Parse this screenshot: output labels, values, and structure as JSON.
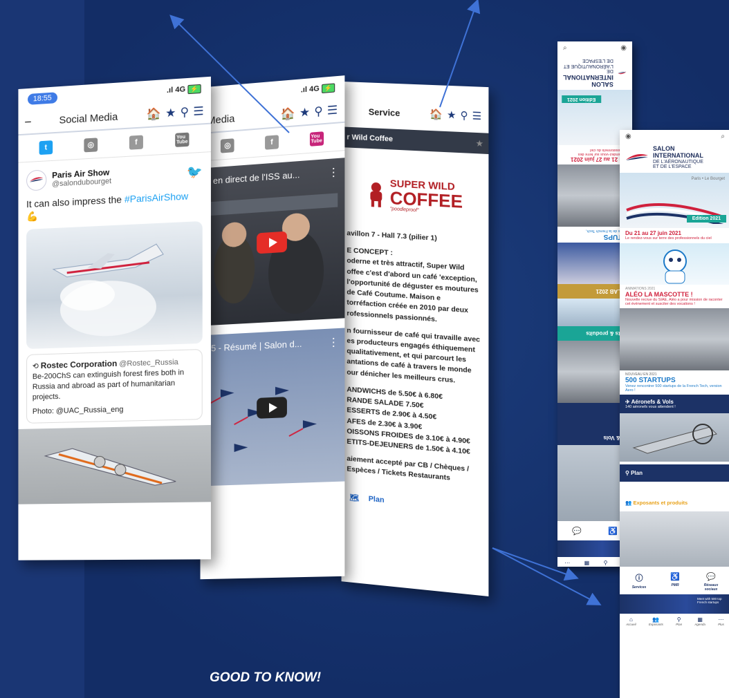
{
  "panel1": {
    "time": "18:55",
    "signal": "4G",
    "title": "Social Media",
    "account_name": "Paris Air Show",
    "account_handle": "@salondubourget",
    "tweet_text": "It can also impress the ",
    "tweet_hashtag": "#ParisAirShow",
    "tweet_emoji": "💪",
    "quote_name": "Rostec Corporation",
    "quote_handle": "@Rostec_Russia",
    "quote_text": "Be-200ChS can extinguish forest fires both in Russia and abroad as part of humanitarian projects.",
    "quote_photo": "Photo: @UAC_Russia_eng"
  },
  "panel2": {
    "signal": "4G",
    "title": "Media",
    "video1_title": "e en direct de l'ISS au...",
    "video2_title": "r 5 - Résumé | Salon d..."
  },
  "panel3": {
    "title": "Service",
    "service_bar": "r Wild Coffee",
    "logo_line1": "SUPER WILD",
    "logo_line2": "COFFEE",
    "logo_tag": "\"poodleproof\"",
    "location": "avillon 7 - Hall 7.3 (pilier 1)",
    "concept_head": "E CONCEPT :",
    "concept_text": "oderne et très attractif, Super Wild offee c'est d'abord un café 'exception, l'opportunité de déguster es moutures de Café Coutume. Maison e torréfaction créée en 2010 par deux rofessionnels passionnés.",
    "supplier_text": "n fournisseur de café qui travaille avec es producteurs engagés éthiquement qualitativement, et qui parcourt les antations de café à travers le monde our dénicher les meilleurs crus.",
    "price1": "ANDWICHS de 5.50€ à 6.80€",
    "price2": "RANDE SALADE 7.50€",
    "price3": "ESSERTS de 2.90€ à 4.50€",
    "price4": "AFES de 2.30€ à 3.90€",
    "price5": "OISSONS FROIDES de 3.10€ à 4.90€",
    "price6": "ETITS-DEJEUNERS de 1.50€ à 4.10€",
    "payment": "aiement accepté par CB / Chèques / Espèces / Tickets Restaurants",
    "plan_label": "Plan"
  },
  "mini1": {
    "salon_title": "SALON INTERNATIONAL",
    "salon_sub": "DE L'AÉRONAUTIQUE ET DE L'ESPACE",
    "edition": "Edition 2021",
    "date": "Du 21 au 27 juin 2021",
    "date_sub": "Le rendez-vous sur terre des professionnels du ciel",
    "lab": "R LAB 2021",
    "exposants": "ants & produits",
    "startups": "PTUPS",
    "aeronefs": "fs & Vols",
    "startups_sub": "rtups de la French Tech,"
  },
  "mini2": {
    "salon_line1": "SALON",
    "salon_line2": "INTERNATIONAL",
    "salon_line3": "DE L'AÉRONAUTIQUE",
    "salon_line4": "ET DE L'ESPACE",
    "paris": "Paris • Le Bourget",
    "edition": "Edition 2021",
    "date": "Du 21 au 27 juin 2021",
    "date_sub": "Le rendez-vous sur terre des professionnels du ciel",
    "anim_kicker": "ANIMATIONS 2021",
    "anim_head": "ALÉO LA MASCOTTE !",
    "anim_sub": "Nouvelle recrue du SIAE, Aléo a pour mission de raconter cet événement et susciter des vocations !",
    "new_kicker": "NOUVEAU EN 2021",
    "new_head": "500 STARTUPS",
    "new_sub": "Venez rencontrer 500 startups de la French Tech, version Aero !",
    "aero_head": "✈ Aéronefs & Vols",
    "aero_sub": "140 aéronefs vous attendent !",
    "plan": "Plan",
    "expo": "Exposants et produits",
    "services": "Services",
    "pmr": "PMR",
    "reseaux": "Réseaux sociaux",
    "banner_text": "Meet with 500 top French startups",
    "tabs": [
      "Accueil",
      "Exposants",
      "Plan",
      "Agenda",
      "Plus"
    ]
  },
  "caption": "GOOD TO KNOW!",
  "colors": {
    "background": "#15326e",
    "navy": "#1c3266",
    "accent_red": "#d0213d",
    "twitter": "#1da1f2"
  }
}
